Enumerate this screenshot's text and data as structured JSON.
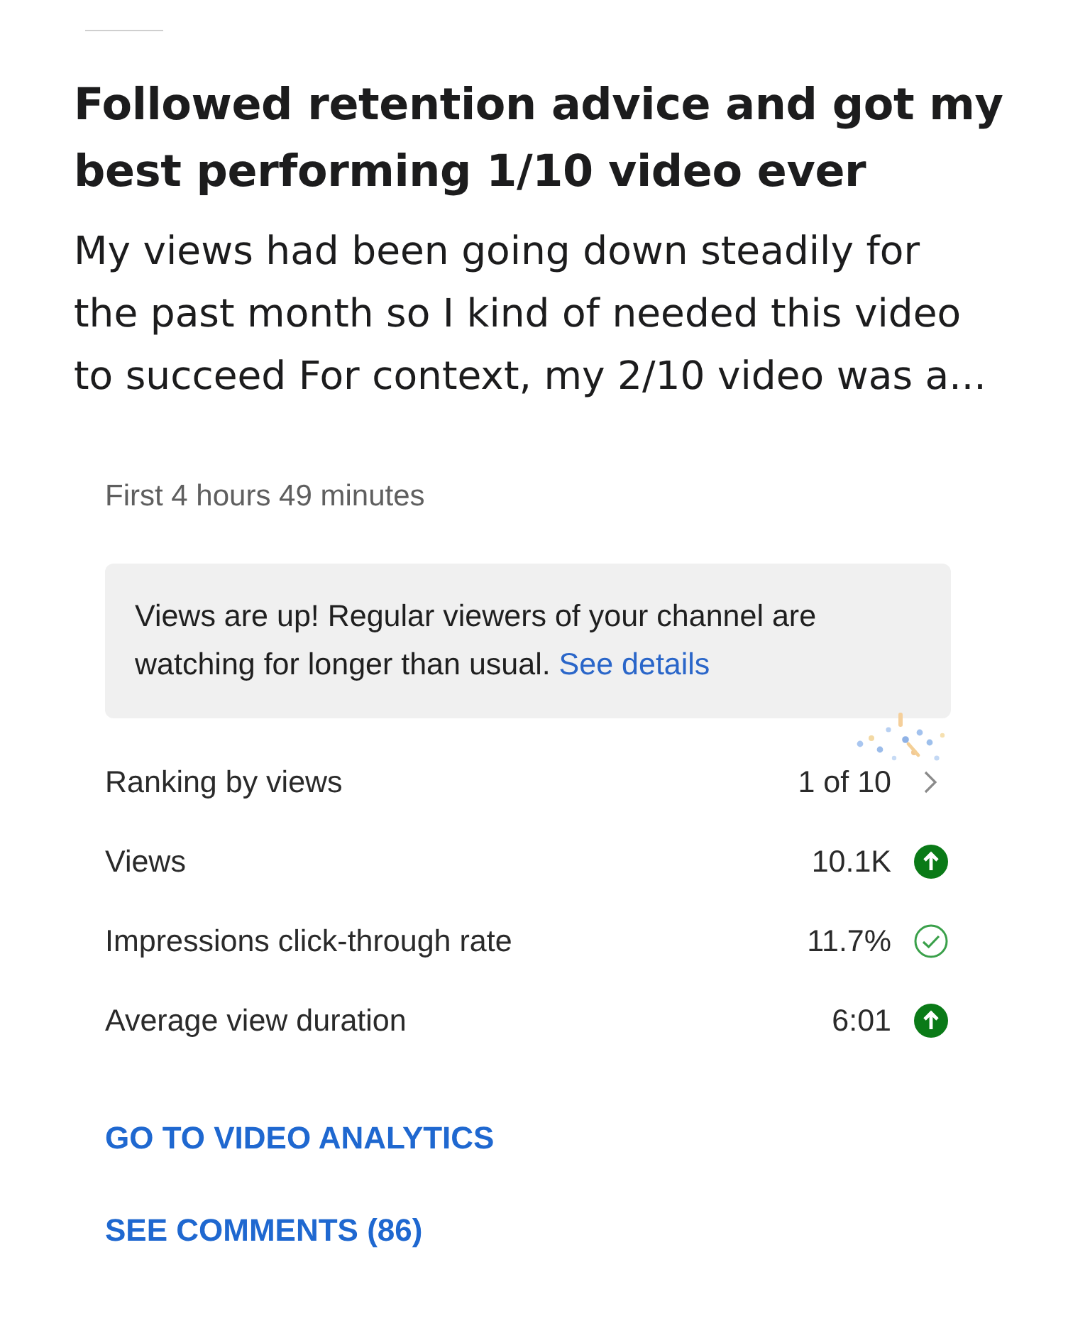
{
  "post": {
    "title": "Followed retention advice and got my best performing 1/10 video ever",
    "body": "My views had been going down steadily for the past month so I kind of needed this video to succeed For context, my 2/10 video was a..."
  },
  "analytics": {
    "period": "First 4 hours 49 minutes",
    "banner": {
      "text": "Views are up! Regular viewers of your channel are watching for longer than usual.",
      "link": "See details"
    },
    "metrics": [
      {
        "label": "Ranking by views",
        "value": "1 of 10",
        "kind": "chevron"
      },
      {
        "label": "Views",
        "value": "10.1K",
        "kind": "up"
      },
      {
        "label": "Impressions click-through rate",
        "value": "11.7%",
        "kind": "check"
      },
      {
        "label": "Average view duration",
        "value": "6:01",
        "kind": "up"
      }
    ],
    "links": [
      "GO TO VIDEO ANALYTICS",
      "SEE COMMENTS (86)"
    ]
  }
}
